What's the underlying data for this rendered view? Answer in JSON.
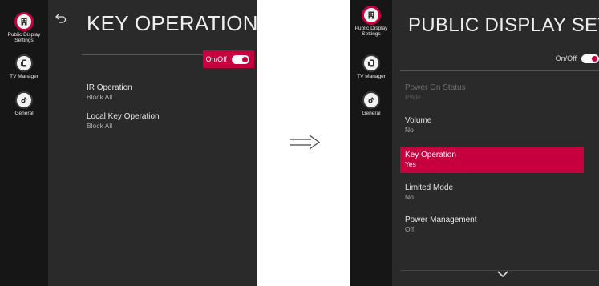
{
  "left_screen": {
    "sidebar": [
      {
        "label": "Public Display Settings",
        "icon": "building-icon",
        "active": true
      },
      {
        "label": "TV Manager",
        "icon": "phone-icon",
        "active": false
      },
      {
        "label": "General",
        "icon": "gear-wrench-icon",
        "active": false
      }
    ],
    "title": "KEY OPERATION",
    "toggle": {
      "label": "On/Off",
      "state": "on"
    },
    "items": [
      {
        "title": "IR Operation",
        "value": "Block All"
      },
      {
        "title": "Local Key Operation",
        "value": "Block All"
      }
    ]
  },
  "arrow": "⟹",
  "right_screen": {
    "sidebar": [
      {
        "label": "Public Display Settings",
        "icon": "building-icon",
        "active": true
      },
      {
        "label": "TV Manager",
        "icon": "phone-icon",
        "active": false
      },
      {
        "label": "General",
        "icon": "gear-wrench-icon",
        "active": false
      }
    ],
    "title": "PUBLIC DISPLAY SETTINGS",
    "toggle": {
      "label": "On/Off",
      "state": "on"
    },
    "items": [
      {
        "title": "Power On Status",
        "value": "PWR",
        "state": "disabled"
      },
      {
        "title": "Volume",
        "value": "No",
        "state": "normal"
      },
      {
        "title": "Key Operation",
        "value": "Yes",
        "state": "selected"
      },
      {
        "title": "Limited Mode",
        "value": "No",
        "state": "normal"
      },
      {
        "title": "Power Management",
        "value": "Off",
        "state": "normal"
      }
    ]
  },
  "colors": {
    "accent": "#c6003f",
    "panel": "#2a2a2a",
    "sidebar": "#161616"
  }
}
